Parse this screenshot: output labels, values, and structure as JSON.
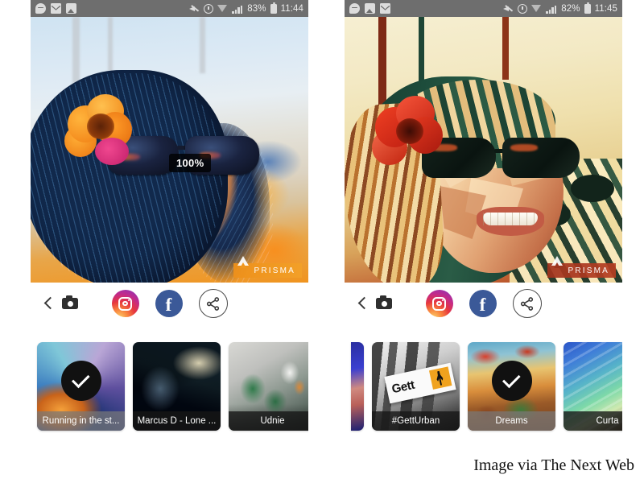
{
  "credit": {
    "text": "Image via The Next Web"
  },
  "phones": [
    {
      "id": "left",
      "statusbar": {
        "left_icons": [
          "messenger-icon",
          "gmail-icon",
          "photos-icon"
        ],
        "right_icons": [
          "mute-icon",
          "alarm-icon",
          "wifi-icon",
          "signal-icon"
        ],
        "battery": "83%",
        "time": "11:44"
      },
      "photo": {
        "intensity_badge": "100%",
        "watermark": "PRISMA",
        "watermark_icon": "prisma-triangle-icon",
        "style_name": "Running in the st..."
      },
      "actions": {
        "back": "back-chevron-icon",
        "camera": "camera-icon",
        "instagram": "instagram-icon",
        "facebook": "facebook-icon",
        "share": "share-icon"
      },
      "filters": [
        {
          "label": "Running in the st...",
          "selected": true,
          "caption_style": "light",
          "art": "art-running"
        },
        {
          "label": "Marcus D - Lone ...",
          "selected": false,
          "caption_style": "dark",
          "art": "art-marcus"
        },
        {
          "label": "Udnie",
          "selected": false,
          "caption_style": "dark",
          "art": "art-udnie"
        }
      ]
    },
    {
      "id": "right",
      "statusbar": {
        "left_icons": [
          "messenger-icon",
          "photos-icon",
          "gmail-icon"
        ],
        "right_icons": [
          "mute-icon",
          "alarm-icon",
          "wifi-icon",
          "signal-icon"
        ],
        "battery": "82%",
        "time": "11:45"
      },
      "photo": {
        "intensity_badge": "",
        "watermark": "PRISMA",
        "watermark_icon": "prisma-triangle-icon",
        "style_name": "Dreams"
      },
      "actions": {
        "back": "back-chevron-icon",
        "camera": "camera-icon",
        "instagram": "instagram-icon",
        "facebook": "facebook-icon",
        "share": "share-icon"
      },
      "filters": [
        {
          "label": "",
          "selected": false,
          "caption_style": "dark",
          "art": "art-partial-left",
          "partial": true
        },
        {
          "label": "#GettUrban",
          "selected": false,
          "caption_style": "dark",
          "art": "art-gett"
        },
        {
          "label": "Dreams",
          "selected": true,
          "caption_style": "light",
          "art": "art-dreams"
        },
        {
          "label": "Curta",
          "selected": false,
          "caption_style": "dark",
          "art": "art-curtain"
        }
      ]
    }
  ],
  "colors": {
    "statusbar_bg": "#6e6e6e",
    "facebook_blue": "#3b5998",
    "check_circle": "#111111",
    "page_bg": "#ffffff"
  }
}
